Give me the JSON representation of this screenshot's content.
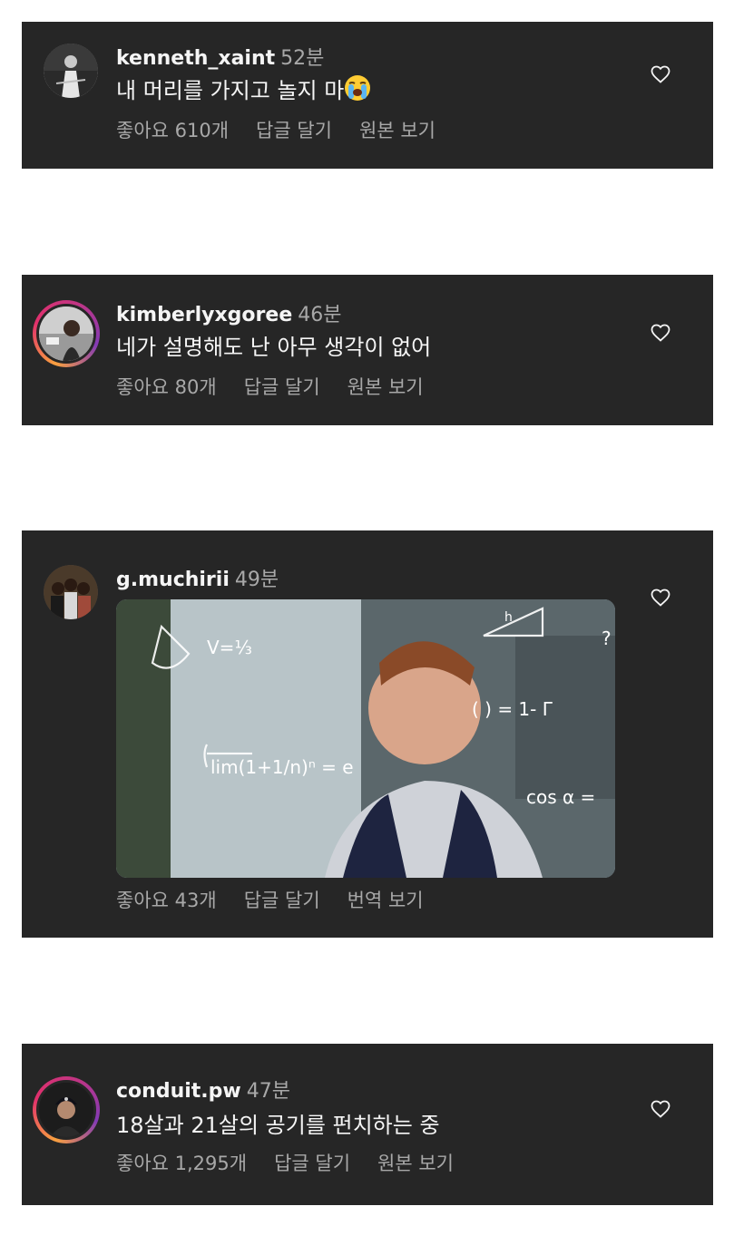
{
  "comments": [
    {
      "username": "kenneth_xaint",
      "time": "52분",
      "text": "내 머리를 가지고 놀지 마",
      "emoji": "loudly-crying-face",
      "likes": "좋아요 610개",
      "reply": "답글 달기",
      "view": "원본 보기"
    },
    {
      "username": "kimberlyxgoree",
      "time": "46분",
      "text": "네가 설명해도 난 아무 생각이 없어",
      "likes": "좋아요 80개",
      "reply": "답글 달기",
      "view": "원본 보기"
    },
    {
      "username": "g.muchirii",
      "time": "49분",
      "gif": {
        "equations": [
          "V=⅓",
          "lim(1+1/n)ⁿ = e",
          "( ) = 1- Γ",
          "cos α = ",
          "?",
          "h"
        ]
      },
      "likes": "좋아요 43개",
      "reply": "답글 달기",
      "view": "번역 보기"
    },
    {
      "username": "conduit.pw",
      "time": "47분",
      "text": "18살과 21살의 공기를 펀치하는 중",
      "likes": "좋아요 1,295개",
      "reply": "답글 달기",
      "view": "원본 보기"
    }
  ],
  "colors": {
    "card_bg": "#262626",
    "text_primary": "#f5f5f5",
    "text_secondary": "#a8a8a8",
    "page_bg": "#ffffff"
  },
  "icons": {
    "like": "heart-outline-icon"
  }
}
